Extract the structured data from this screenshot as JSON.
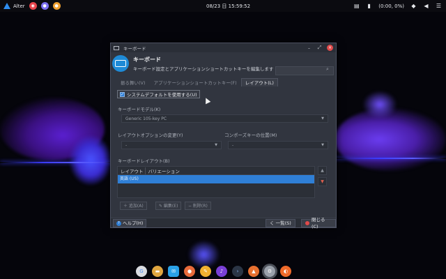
{
  "top_panel": {
    "logo_text": "Alter",
    "clock": "08/23 日 15:59:52",
    "battery_text": "(0:00, 0%)",
    "icons": [
      "clipboard-icon",
      "battery-icon",
      "wifi-icon",
      "volume-icon",
      "notifications-icon"
    ]
  },
  "window": {
    "title": "キーボード",
    "header_title": "キーボード",
    "header_desc": "キーボード設定とアプリケーションショートカットキーを編集します",
    "tabs": [
      {
        "label": "振る舞い(V)",
        "active": false
      },
      {
        "label": "アプリケーションショートカットキー(F)",
        "active": false
      },
      {
        "label": "レイアウト(L)",
        "active": true
      }
    ],
    "use_system_default": {
      "label": "システムデフォルトを使用する(U)",
      "checked": true
    },
    "model_label": "キーボードモデル(K)",
    "model_value": "Generic 105-key PC",
    "layout_option_label": "レイアウトオプションの変更(Y)",
    "layout_option_value": "-",
    "compose_label": "コンポーズキーの位置(M)",
    "compose_value": "-",
    "layout_list_label": "キーボードレイアウト(B)",
    "layout_columns": [
      "レイアウト",
      "バリエーション"
    ],
    "layout_rows": [
      "英語 (US)"
    ],
    "add_button": "＋ 追加(A)",
    "edit_button": "✎ 編集(E)",
    "remove_button": "− 削除(R)",
    "help_button": "ヘルプ(H)",
    "back_button": "く 一覧(S)",
    "close_button": "閉じる(C)"
  }
}
